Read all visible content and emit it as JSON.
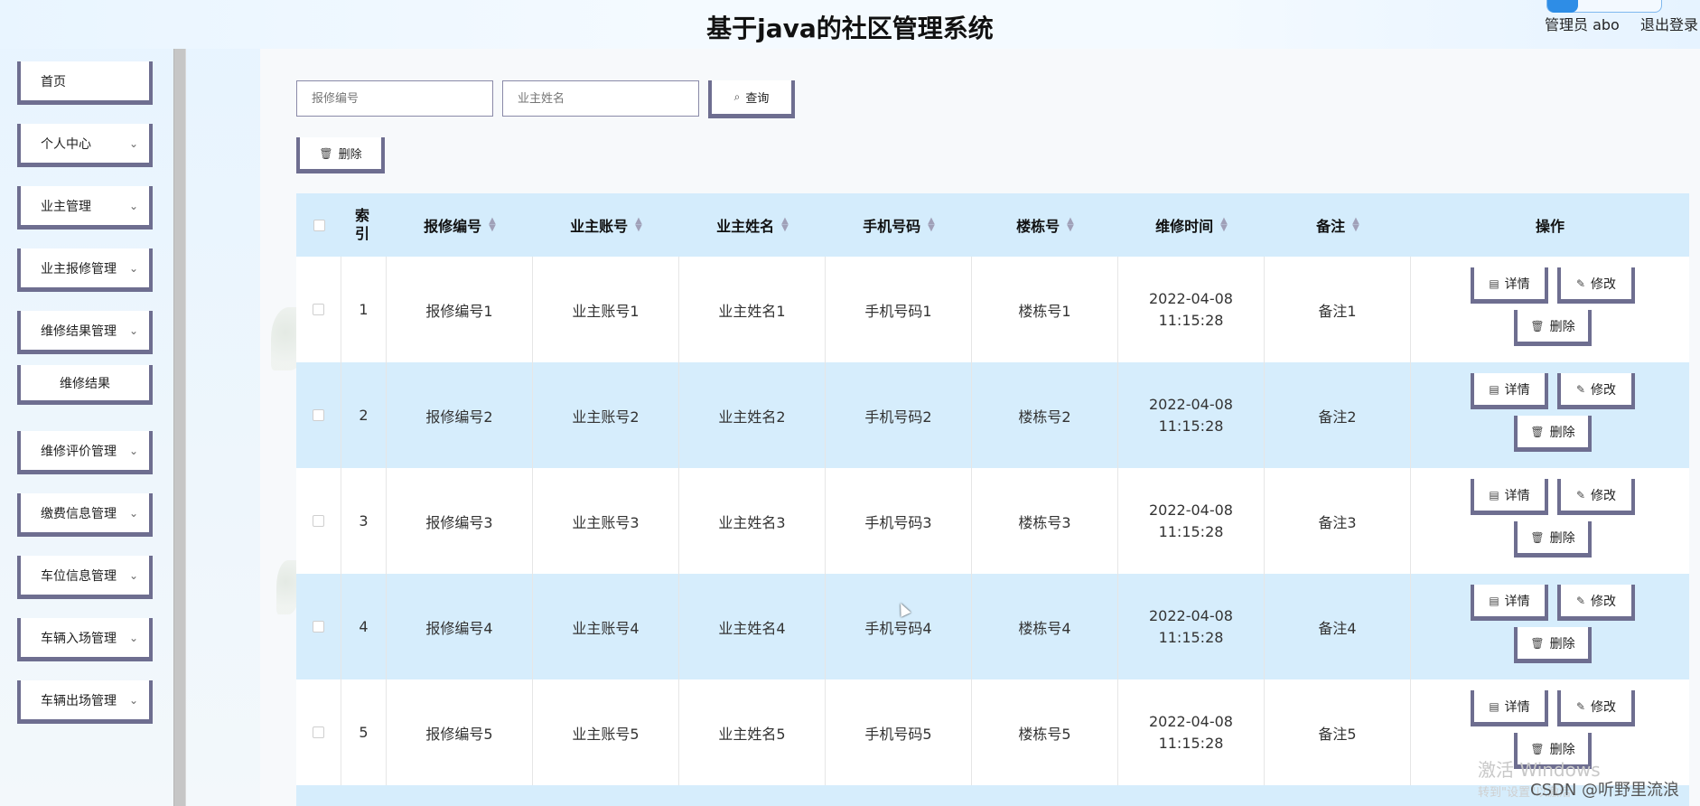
{
  "header": {
    "title": "基于java的社区管理系统",
    "admin_label": "管理员 abo",
    "logout_label": "退出登录"
  },
  "sidebar": {
    "items": [
      {
        "label": "首页",
        "has_chevron": false
      },
      {
        "label": "个人中心",
        "has_chevron": true
      },
      {
        "label": "业主管理",
        "has_chevron": true
      },
      {
        "label": "业主报修管理",
        "has_chevron": true
      },
      {
        "label": "维修结果管理",
        "has_chevron": true
      },
      {
        "label": "维修结果",
        "sub": true
      },
      {
        "label": "维修评价管理",
        "has_chevron": true
      },
      {
        "label": "缴费信息管理",
        "has_chevron": true
      },
      {
        "label": "车位信息管理",
        "has_chevron": true
      },
      {
        "label": "车辆入场管理",
        "has_chevron": true
      },
      {
        "label": "车辆出场管理",
        "has_chevron": true
      }
    ]
  },
  "search": {
    "repair_no_placeholder": "报修编号",
    "owner_name_placeholder": "业主姓名",
    "query_label": "查询",
    "delete_label": "删除"
  },
  "table": {
    "headers": {
      "index": "索引",
      "repair_no": "报修编号",
      "owner_account": "业主账号",
      "owner_name": "业主姓名",
      "phone": "手机号码",
      "building": "楼栋号",
      "repair_time": "维修时间",
      "remark": "备注",
      "actions": "操作"
    },
    "rows": [
      {
        "index": "1",
        "repair_no": "报修编号1",
        "owner_account": "业主账号1",
        "owner_name": "业主姓名1",
        "phone": "手机号码1",
        "building": "楼栋号1",
        "repair_time": "2022-04-08 11:15:28",
        "remark": "备注1"
      },
      {
        "index": "2",
        "repair_no": "报修编号2",
        "owner_account": "业主账号2",
        "owner_name": "业主姓名2",
        "phone": "手机号码2",
        "building": "楼栋号2",
        "repair_time": "2022-04-08 11:15:28",
        "remark": "备注2"
      },
      {
        "index": "3",
        "repair_no": "报修编号3",
        "owner_account": "业主账号3",
        "owner_name": "业主姓名3",
        "phone": "手机号码3",
        "building": "楼栋号3",
        "repair_time": "2022-04-08 11:15:28",
        "remark": "备注3"
      },
      {
        "index": "4",
        "repair_no": "报修编号4",
        "owner_account": "业主账号4",
        "owner_name": "业主姓名4",
        "phone": "手机号码4",
        "building": "楼栋号4",
        "repair_time": "2022-04-08 11:15:28",
        "remark": "备注4"
      },
      {
        "index": "5",
        "repair_no": "报修编号5",
        "owner_account": "业主账号5",
        "owner_name": "业主姓名5",
        "phone": "手机号码5",
        "building": "楼栋号5",
        "repair_time": "2022-04-08 11:15:28",
        "remark": "备注5"
      }
    ],
    "actions": {
      "detail_label": "详情",
      "edit_label": "修改",
      "delete_label": "删除"
    }
  },
  "overlay": {
    "activate_windows": "激活 Windows",
    "activate_windows_hint": "转到\"设置\"以激活",
    "csdn_watermark": "CSDN @听野里流浪"
  },
  "colors": {
    "header_bg": "#e9f5ff",
    "table_header_bg": "#d4ecfc",
    "row_alt_bg": "#d6edfc",
    "button_border": "#6e6e90"
  }
}
